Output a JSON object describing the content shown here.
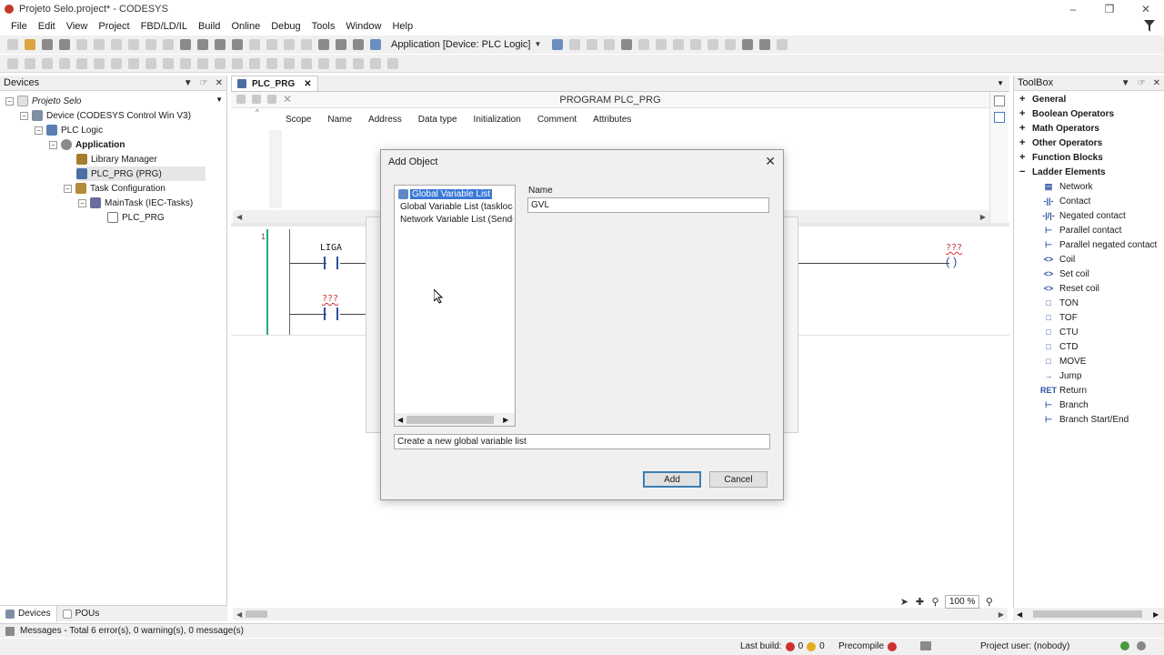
{
  "window": {
    "title": "Projeto Selo.project* - CODESYS"
  },
  "menu": [
    "File",
    "Edit",
    "View",
    "Project",
    "FBD/LD/IL",
    "Build",
    "Online",
    "Debug",
    "Tools",
    "Window",
    "Help"
  ],
  "toolbar": {
    "active_app": "Application [Device: PLC Logic]"
  },
  "devices_panel": {
    "title": "Devices",
    "tree": [
      {
        "label": "Projeto Selo"
      },
      {
        "label": "Device (CODESYS Control Win V3)"
      },
      {
        "label": "PLC Logic"
      },
      {
        "label": "Application"
      },
      {
        "label": "Library Manager"
      },
      {
        "label": "PLC_PRG (PRG)"
      },
      {
        "label": "Task Configuration"
      },
      {
        "label": "MainTask (IEC-Tasks)"
      },
      {
        "label": "PLC_PRG"
      }
    ],
    "bottom_tabs": [
      "Devices",
      "POUs"
    ]
  },
  "editor": {
    "tab_label": "PLC_PRG",
    "program_header": "PROGRAM PLC_PRG",
    "columns": [
      "Scope",
      "Name",
      "Address",
      "Data type",
      "Initialization",
      "Comment",
      "Attributes"
    ],
    "network_number": "1",
    "ladder": {
      "contact1": "LIGA",
      "contact2": "???",
      "coil": "???"
    },
    "zoom": "100 %"
  },
  "dialog": {
    "title": "Add Object",
    "items": [
      "Global Variable List",
      "Global Variable List (taskloca",
      "Network Variable List (Sende"
    ],
    "name_label": "Name",
    "name_value": "GVL",
    "description": "Create a new global variable list",
    "add_button": "Add",
    "cancel_button": "Cancel"
  },
  "toolbox": {
    "title": "ToolBox",
    "categories": [
      "General",
      "Boolean Operators",
      "Math Operators",
      "Other Operators",
      "Function Blocks",
      "Ladder Elements"
    ],
    "ladder_elements": [
      "Network",
      "Contact",
      "Negated contact",
      "Parallel contact",
      "Parallel negated contact",
      "Coil",
      "Set coil",
      "Reset coil",
      "TON",
      "TOF",
      "CTU",
      "CTD",
      "MOVE",
      "Jump",
      "Return",
      "Branch",
      "Branch Start/End"
    ]
  },
  "messages": "Messages - Total 6 error(s), 0 warning(s), 0 message(s)",
  "status": {
    "last_build_label": "Last build:",
    "errors": "0",
    "warnings": "0",
    "precompile": "Precompile",
    "project_user": "Project user: (nobody)"
  }
}
